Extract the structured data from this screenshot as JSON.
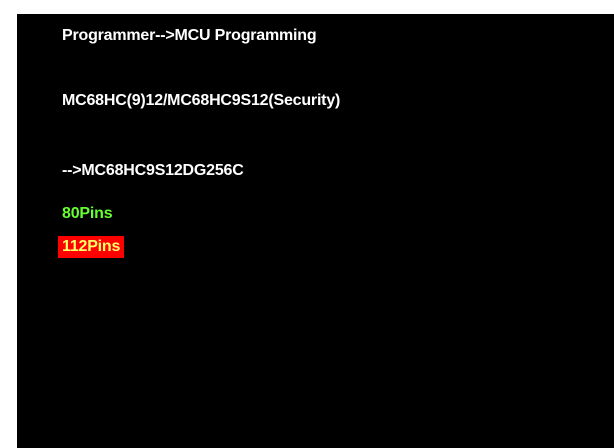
{
  "header": {
    "breadcrumb": "Programmer-->MCU Programming"
  },
  "selection": {
    "family": "MC68HC(9)12/MC68HC9S12(Security)",
    "model": "-->MC68HC9S12DG256C"
  },
  "options": [
    {
      "label": "80Pins",
      "selected": false,
      "text_color": "#66ff33"
    },
    {
      "label": "112Pins",
      "selected": true,
      "text_color": "#ffff66",
      "highlight_color": "#ff0000"
    }
  ],
  "colors": {
    "background": "#000000",
    "text": "#ffffff"
  }
}
